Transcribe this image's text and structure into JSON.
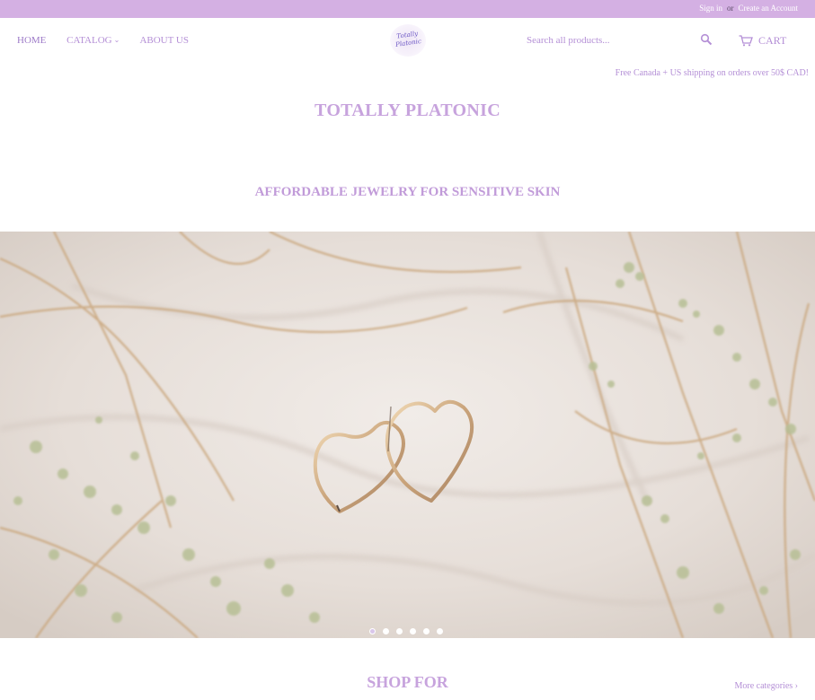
{
  "account": {
    "sign_in": "Sign in",
    "or": "or",
    "create": "Create an Account"
  },
  "nav": {
    "home": "HOME",
    "catalog": "CATALOG",
    "catalog_caret": "⌄",
    "about": "ABOUT US"
  },
  "logo": {
    "text": "Totally Platonic"
  },
  "search": {
    "placeholder": "Search all products..."
  },
  "cart": {
    "label": "CART"
  },
  "shipping_notice": "Free Canada + US shipping on orders over 50$ CAD!",
  "site_title": "TOTALLY PLATONIC",
  "tagline": "AFFORDABLE JEWELRY FOR SENSITIVE SKIN",
  "slideshow": {
    "slide_count": 6,
    "active_index": 0
  },
  "shop_section": {
    "title": "SHOP FOR",
    "more_link": "More categories ›"
  },
  "colors": {
    "accent": "#b48fd6",
    "topbar": "#d4b0e3",
    "title": "#c7a3dd"
  }
}
